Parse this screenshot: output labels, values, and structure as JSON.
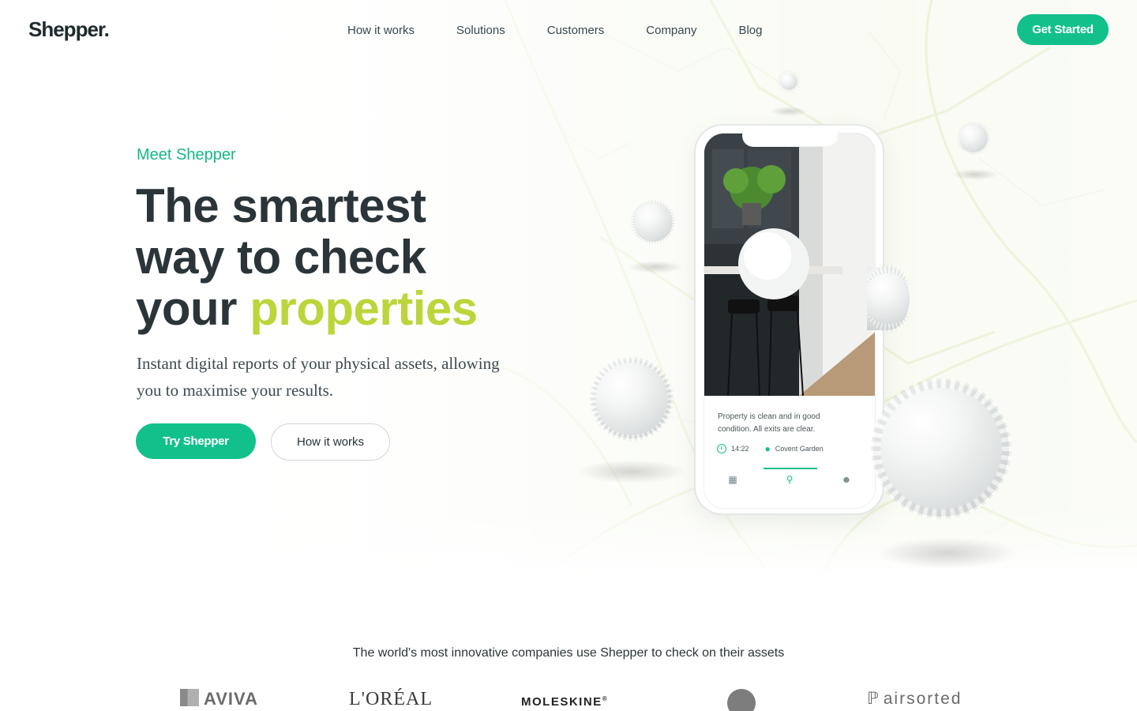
{
  "header": {
    "logo": "Shepper.",
    "nav": [
      "How it works",
      "Solutions",
      "Customers",
      "Company",
      "Blog"
    ],
    "cta": "Get Started"
  },
  "hero": {
    "eyebrow": "Meet Shepper",
    "headline_line1": "The smartest",
    "headline_line2": "way to check",
    "headline_line3_prefix": "your ",
    "headline_line3_accent": "properties",
    "subtext": "Instant digital reports of your physical assets, allowing you to maximise your results.",
    "primary_button": "Try Shepper",
    "secondary_button": "How it works"
  },
  "phone": {
    "caption": "Property is clean and in good condition. All exits are clear.",
    "time": "14:22",
    "location": "Covent Garden",
    "tabs": [
      {
        "icon": "building-icon",
        "active": false
      },
      {
        "icon": "search-icon",
        "active": true
      },
      {
        "icon": "user-icon",
        "active": false
      }
    ]
  },
  "customers": {
    "title": "The world's most innovative companies use Shepper to check on their assets",
    "logos": [
      "AVIVA",
      "L'ORÉAL",
      "MOLESKINE",
      "",
      "airsorted"
    ],
    "moleskine_mark": "®"
  },
  "colors": {
    "brand_green": "#12c08c",
    "accent_lime": "#bcd53a",
    "text_dark": "#2b3539"
  }
}
